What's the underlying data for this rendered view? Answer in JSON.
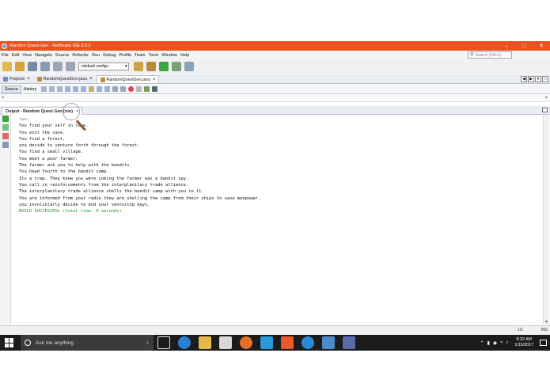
{
  "window": {
    "title": "Random Quest-Gen - NetBeans IDE 8.0.2",
    "controls": {
      "minimize": "–",
      "maximize": "□",
      "close": "✕"
    }
  },
  "menubar": {
    "items": [
      "File",
      "Edit",
      "View",
      "Navigate",
      "Source",
      "Refactor",
      "Run",
      "Debug",
      "Profile",
      "Team",
      "Tools",
      "Window",
      "Help"
    ],
    "search_placeholder": "Search (Ctrl+I)"
  },
  "toolbar": {
    "config_value": "<default config>"
  },
  "tabs": [
    {
      "label": "Projects",
      "active": false
    },
    {
      "label": "RandomQuestGen.java",
      "active": false
    },
    {
      "label": "RandomQuestGen.java",
      "active": true
    }
  ],
  "editor": {
    "source_tab": "Source",
    "history_tab": "History"
  },
  "breadcrumb": ">",
  "output": {
    "tab_label": "Output - Random Quest Gen (run)",
    "lines": [
      "run:",
      "You find your self in cave.",
      "You exit the cave.",
      "You find a forest.",
      "you decide to venture forth through the forest.",
      "You find a small village.",
      "You meet a poor farmer.",
      "The farmer ask you to help with the bandits.",
      "You head fourth to the bandit camp.",
      "Its a trap. They knew you were coming the farmer was a bandit spy.",
      "You call in reinforcements from the interplanitary trade allience.",
      "The interplanitary trade allience shells the bandit camp with you in it.",
      "You are informed from your radio they are shelling the camp from their ships to save manpower.",
      "you involintarly decide to end your venturing days.",
      "BUILD SUCCESSFUL (total time: 0 seconds)"
    ]
  },
  "statusbar": {
    "position": "1/1",
    "mode": "INS"
  },
  "taskbar": {
    "search_placeholder": "Ask me anything",
    "time": "8:32 AM",
    "date": "1/15/2017"
  },
  "colors": {
    "titlebar": "#e8541f",
    "build_success": "#1a9a1a",
    "taskbar": "#1c1c1c"
  }
}
